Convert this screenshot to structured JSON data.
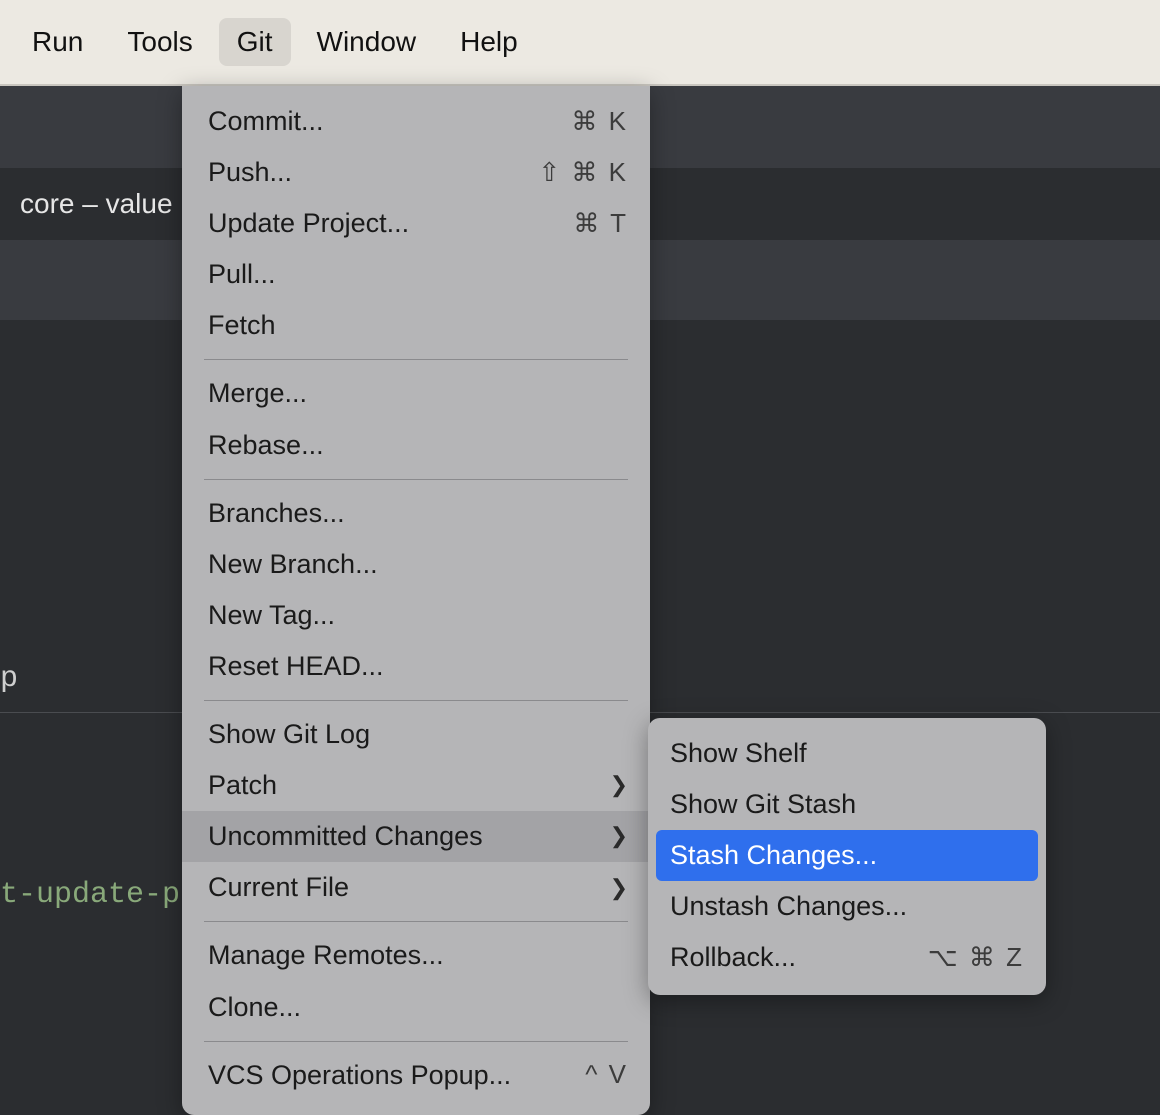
{
  "menubar": {
    "items": [
      {
        "label": "Run",
        "active": false
      },
      {
        "label": "Tools",
        "active": false
      },
      {
        "label": "Git",
        "active": true
      },
      {
        "label": "Window",
        "active": false
      },
      {
        "label": "Help",
        "active": false
      }
    ]
  },
  "editor": {
    "tab_label": "core – value",
    "code_fragment_1": "p",
    "code_fragment_2": "t-update-pt"
  },
  "git_menu": {
    "groups": [
      [
        {
          "label": "Commit...",
          "shortcut": "⌘ K",
          "submenu": false
        },
        {
          "label": "Push...",
          "shortcut": "⇧ ⌘ K",
          "submenu": false
        },
        {
          "label": "Update Project...",
          "shortcut": "⌘ T",
          "submenu": false
        },
        {
          "label": "Pull...",
          "shortcut": "",
          "submenu": false
        },
        {
          "label": "Fetch",
          "shortcut": "",
          "submenu": false
        }
      ],
      [
        {
          "label": "Merge...",
          "shortcut": "",
          "submenu": false
        },
        {
          "label": "Rebase...",
          "shortcut": "",
          "submenu": false
        }
      ],
      [
        {
          "label": "Branches...",
          "shortcut": "",
          "submenu": false
        },
        {
          "label": "New Branch...",
          "shortcut": "",
          "submenu": false
        },
        {
          "label": "New Tag...",
          "shortcut": "",
          "submenu": false
        },
        {
          "label": "Reset HEAD...",
          "shortcut": "",
          "submenu": false
        }
      ],
      [
        {
          "label": "Show Git Log",
          "shortcut": "",
          "submenu": false
        },
        {
          "label": "Patch",
          "shortcut": "",
          "submenu": true
        },
        {
          "label": "Uncommitted Changes",
          "shortcut": "",
          "submenu": true,
          "hover": true
        },
        {
          "label": "Current File",
          "shortcut": "",
          "submenu": true
        }
      ],
      [
        {
          "label": "Manage Remotes...",
          "shortcut": "",
          "submenu": false
        },
        {
          "label": "Clone...",
          "shortcut": "",
          "submenu": false
        }
      ],
      [
        {
          "label": "VCS Operations Popup...",
          "shortcut": "^ V",
          "submenu": false
        }
      ]
    ]
  },
  "uncommitted_changes_submenu": {
    "items": [
      {
        "label": "Show Shelf",
        "shortcut": "",
        "selected": false
      },
      {
        "label": "Show Git Stash",
        "shortcut": "",
        "selected": false
      },
      {
        "label": "Stash Changes...",
        "shortcut": "",
        "selected": true
      },
      {
        "label": "Unstash Changes...",
        "shortcut": "",
        "selected": false
      },
      {
        "label": "Rollback...",
        "shortcut": "⌥ ⌘ Z",
        "selected": false
      }
    ]
  }
}
